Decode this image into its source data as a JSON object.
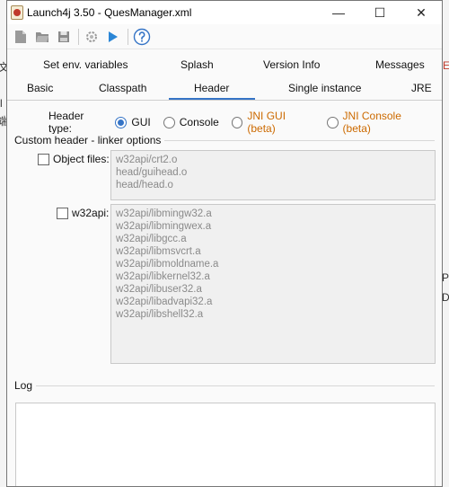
{
  "window": {
    "title": "Launch4j 3.50 - QuesManager.xml"
  },
  "window_controls": {
    "minimize": "—",
    "maximize": "☐",
    "close": "✕"
  },
  "background_glyphs": {
    "left_1": "文",
    "left_2": "l",
    "left_3": "端",
    "right_1": "E",
    "right_2": "P",
    "right_3": "D"
  },
  "tabs": {
    "row1": [
      "Set env. variables",
      "Splash",
      "Version Info",
      "Messages"
    ],
    "row2": [
      "Basic",
      "Classpath",
      "Header",
      "Single instance",
      "JRE"
    ],
    "active": "Header"
  },
  "header_type": {
    "label": "Header type:",
    "options": [
      "GUI",
      "Console",
      "JNI GUI (beta)",
      "JNI Console (beta)"
    ],
    "selected": "GUI",
    "beta_color": "#cc6a00"
  },
  "custom_header": {
    "title": "Custom header - linker options",
    "object_files": {
      "label": "Object files:",
      "checked": false,
      "items": [
        "w32api/crt2.o",
        "head/guihead.o",
        "head/head.o"
      ]
    },
    "w32api": {
      "label": "w32api:",
      "checked": false,
      "items": [
        "w32api/libmingw32.a",
        "w32api/libmingwex.a",
        "w32api/libgcc.a",
        "w32api/libmsvcrt.a",
        "w32api/libmoldname.a",
        "w32api/libkernel32.a",
        "w32api/libuser32.a",
        "w32api/libadvapi32.a",
        "w32api/libshell32.a"
      ]
    }
  },
  "log": {
    "title": "Log",
    "content": ""
  },
  "colors": {
    "accent": "#3574c6"
  }
}
